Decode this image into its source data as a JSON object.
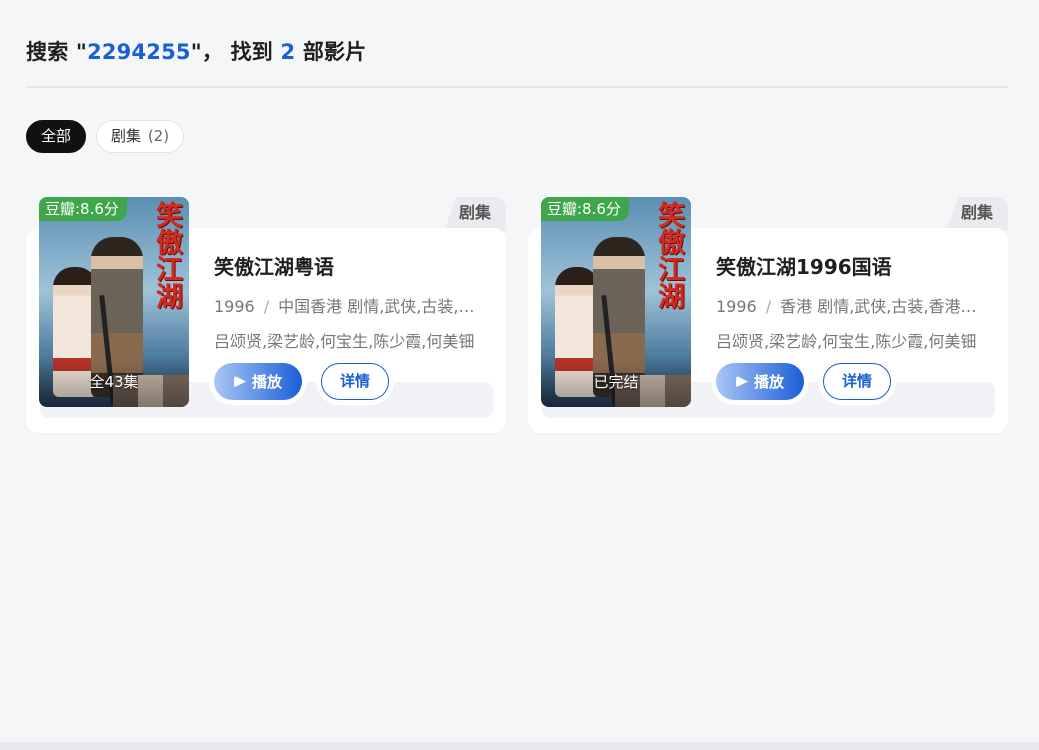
{
  "search": {
    "prefix": "搜索 \"",
    "query": "2294255",
    "mid": "\"， 找到 ",
    "count": "2",
    "suffix": " 部影片"
  },
  "filters": [
    {
      "label": "全部",
      "count": "",
      "active": true
    },
    {
      "label": "剧集",
      "count": "(2)",
      "active": false
    }
  ],
  "results": [
    {
      "type": "剧集",
      "rating": "豆瓣:8.6分",
      "episodes": "全43集",
      "poster_title": "笑傲江湖",
      "title": "笑傲江湖粤语",
      "year": "1996",
      "genres": "中国香港 剧情,武侠,古装,香港",
      "cast": "吕颂贤,梁艺龄,何宝生,陈少霞,何美钿",
      "play_label": "播放",
      "detail_label": "详情"
    },
    {
      "type": "剧集",
      "rating": "豆瓣:8.6分",
      "episodes": "已完结",
      "poster_title": "笑傲江湖",
      "title": "笑傲江湖1996国语",
      "year": "1996",
      "genres": "香港 剧情,武侠,古装,香港,中国",
      "cast": "吕颂贤,梁艺龄,何宝生,陈少霞,何美钿",
      "play_label": "播放",
      "detail_label": "详情"
    }
  ],
  "colors": {
    "accent": "#1a5fd6",
    "rating_badge": "#3fa74a",
    "active_chip": "#111111",
    "background": "#f5f6f8"
  }
}
